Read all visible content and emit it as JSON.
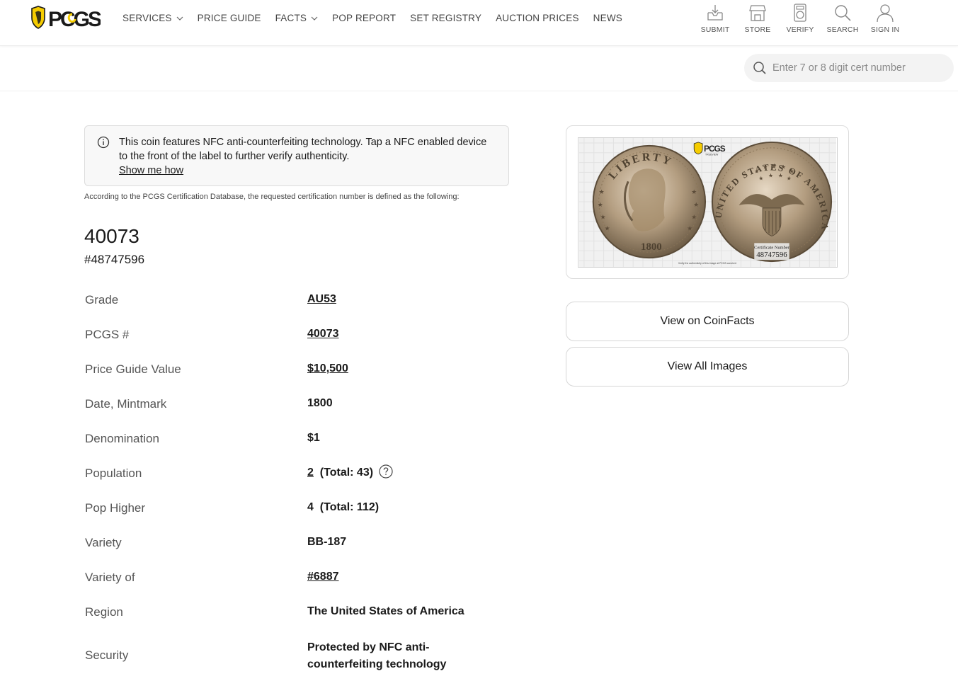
{
  "header": {
    "logo_text": "PCGS",
    "nav": [
      {
        "label": "SERVICES",
        "dropdown": true
      },
      {
        "label": "PRICE GUIDE",
        "dropdown": false
      },
      {
        "label": "FACTS",
        "dropdown": true
      },
      {
        "label": "POP REPORT",
        "dropdown": false
      },
      {
        "label": "SET REGISTRY",
        "dropdown": false
      },
      {
        "label": "AUCTION PRICES",
        "dropdown": false
      },
      {
        "label": "NEWS",
        "dropdown": false
      }
    ],
    "tools": [
      {
        "label": "SUBMIT",
        "icon": "submit-tray-icon"
      },
      {
        "label": "STORE",
        "icon": "store-icon"
      },
      {
        "label": "VERIFY",
        "icon": "verify-slab-icon"
      },
      {
        "label": "SEARCH",
        "icon": "search-icon"
      },
      {
        "label": "SIGN IN",
        "icon": "user-icon"
      }
    ]
  },
  "cert_search": {
    "placeholder": "Enter 7 or 8 digit cert number"
  },
  "notice": {
    "text": "This coin features NFC anti-counterfeiting technology. Tap a NFC enabled device to the front of the label to further verify authenticity.",
    "link": "Show me how"
  },
  "intro": "According to the PCGS Certification Database, the requested certification number is defined as the following:",
  "coin": {
    "title": "40073",
    "cert_number": "#48747596"
  },
  "details": {
    "grade": {
      "label": "Grade",
      "value": "AU53"
    },
    "pcgs_no": {
      "label": "PCGS #",
      "value": "40073"
    },
    "price_guide": {
      "label": "Price Guide Value",
      "value": "$10,500"
    },
    "date_mintmark": {
      "label": "Date, Mintmark",
      "value": "1800"
    },
    "denomination": {
      "label": "Denomination",
      "value": "$1"
    },
    "population": {
      "label": "Population",
      "value": "2",
      "total": "(Total: 43)"
    },
    "pop_higher": {
      "label": "Pop Higher",
      "value": "4",
      "total": "(Total: 112)"
    },
    "variety": {
      "label": "Variety",
      "value": "BB-187"
    },
    "variety_of": {
      "label": "Variety of",
      "value": "#6887"
    },
    "region": {
      "label": "Region",
      "value": "The United States of America"
    },
    "security": {
      "label": "Security",
      "value": "Protected by NFC anti-counterfeiting technology"
    }
  },
  "image": {
    "obverse_top": "LIBERTY",
    "obverse_date": "1800",
    "reverse_legend": "UNITED STATES OF AMERICA",
    "label_heading": "Certificate Number",
    "label_number": "48747596",
    "badge": "PCGS",
    "badge_sub": "TRUEVIEW",
    "footer_text": "Verify the authenticity of this image at PCGS.com/cert"
  },
  "buttons": {
    "coinfacts": "View on CoinFacts",
    "all_images": "View All Images"
  },
  "colors": {
    "brand_yellow": "#f5cc00",
    "text": "#1a1a1a",
    "muted": "#555555",
    "border": "#dcdcdc"
  }
}
